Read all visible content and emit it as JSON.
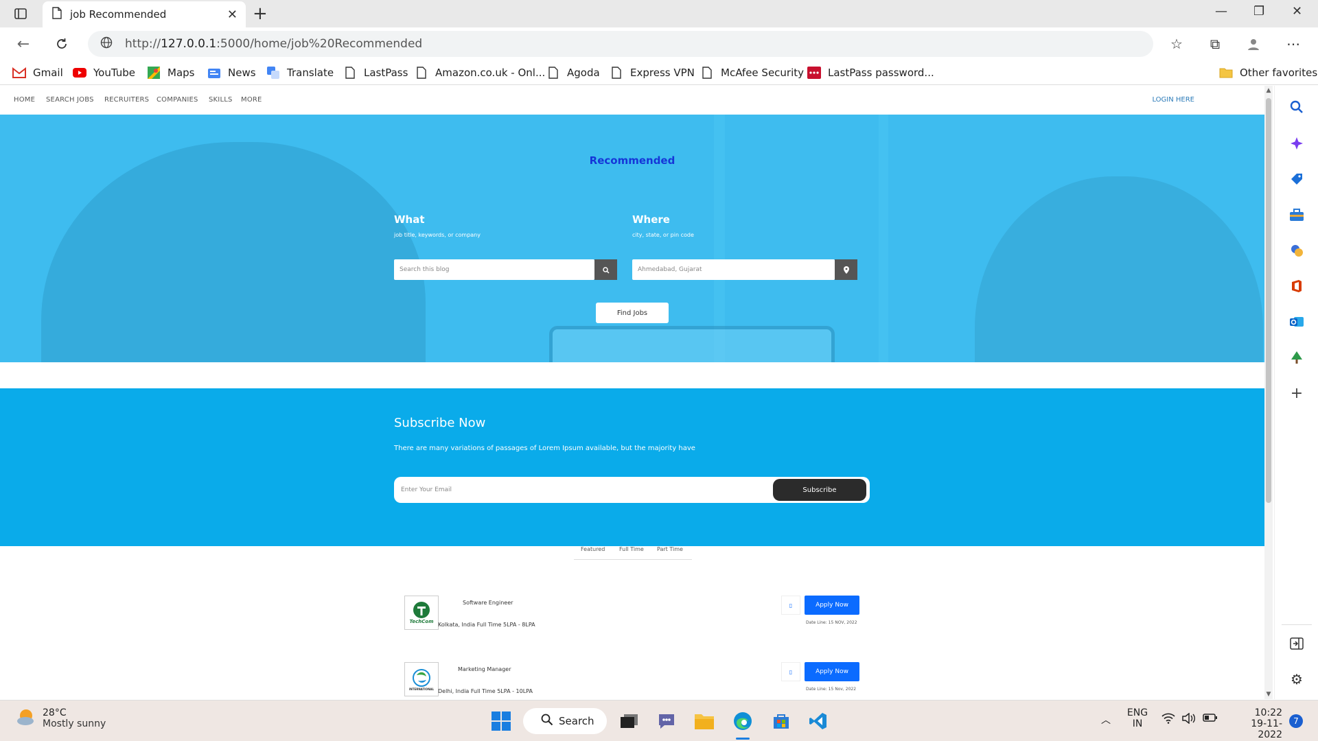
{
  "browser": {
    "tab_title": "job Recommended",
    "url_prefix": "http://",
    "url_host": "127.0.0.1",
    "url_rest": ":5000/home/job%20Recommended",
    "bookmarks": [
      {
        "label": "Gmail",
        "icon": "gmail-icon"
      },
      {
        "label": "YouTube",
        "icon": "youtube-icon"
      },
      {
        "label": "Maps",
        "icon": "maps-icon"
      },
      {
        "label": "News",
        "icon": "news-icon"
      },
      {
        "label": "Translate",
        "icon": "translate-icon"
      },
      {
        "label": "LastPass",
        "icon": "document-icon"
      },
      {
        "label": "Amazon.co.uk - Onl...",
        "icon": "document-icon"
      },
      {
        "label": "Agoda",
        "icon": "document-icon"
      },
      {
        "label": "Express VPN",
        "icon": "document-icon"
      },
      {
        "label": "McAfee Security",
        "icon": "document-icon"
      },
      {
        "label": "LastPass password...",
        "icon": "lastpass-icon"
      }
    ],
    "other_favorites": "Other favorites"
  },
  "site": {
    "nav": [
      "HOME",
      "SEARCH JOBS",
      "RECRUITERS",
      "COMPANIES",
      "SKILLS",
      "MORE"
    ],
    "login": "LOGIN HERE"
  },
  "hero": {
    "heading": "Recommended",
    "what_label": "What",
    "what_sub": "job title, keywords, or company",
    "what_placeholder": "Search this blog",
    "where_label": "Where",
    "where_sub": "city, state, or pin code",
    "where_value": "Ahmedabad, Gujarat",
    "find_button": "Find Jobs"
  },
  "subscribe": {
    "heading": "Subscribe Now",
    "text": "There are many variations of passages of Lorem Ipsum available, but the majority have",
    "placeholder": "Enter Your Email",
    "button": "Subscribe"
  },
  "job_tabs": [
    "Featured",
    "Full Time",
    "Part Time"
  ],
  "jobs": [
    {
      "title": "Software Engineer",
      "meta": "Kolkata, India Full Time 5LPA - 8LPA",
      "logo_text": "TechCom",
      "apply": "Apply Now",
      "date": "Date Line: 15 NOV, 2022"
    },
    {
      "title": "Marketing Manager",
      "meta": "Delhi, India Full Time 5LPA - 10LPA",
      "logo_text": "INTERNATIONAL",
      "apply": "Apply Now",
      "date": "Date Line: 15 Nov, 2022"
    }
  ],
  "taskbar": {
    "temperature": "28°C",
    "weather": "Mostly sunny",
    "search": "Search",
    "lang1": "ENG",
    "lang2": "IN",
    "time": "10:22",
    "date": "19-11-2022",
    "badge": "7"
  },
  "colors": {
    "hero_bg": "#3ebcef",
    "subscribe_bg": "#0aabea",
    "apply_blue": "#0b6bff",
    "heading_blue": "#1536d8"
  }
}
